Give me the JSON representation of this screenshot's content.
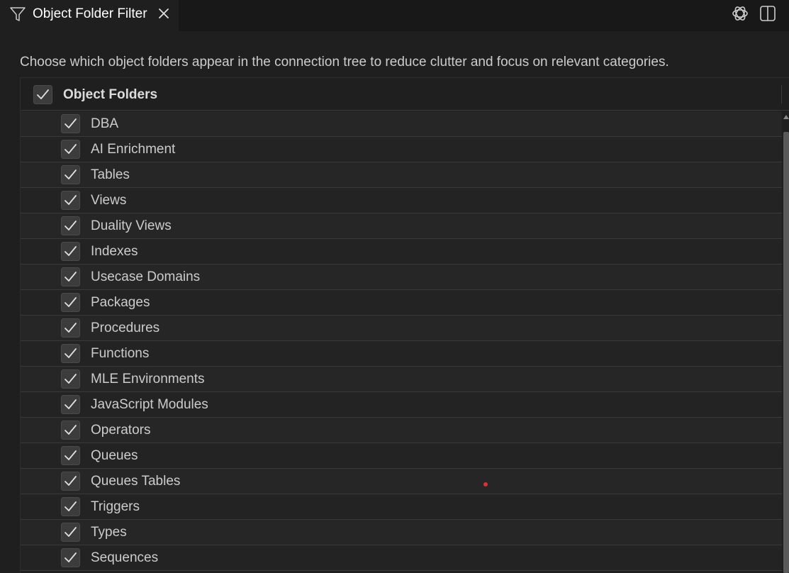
{
  "tab": {
    "title": "Object Folder Filter",
    "icon": "filter-icon"
  },
  "top_right_icons": [
    "openai-icon",
    "split-editor-icon"
  ],
  "description": "Choose which object folders appear in the connection tree to reduce clutter and focus on relevant categories.",
  "tree": {
    "header_label": "Object Folders",
    "header_checked": true,
    "items": [
      {
        "label": "DBA",
        "checked": true
      },
      {
        "label": "AI Enrichment",
        "checked": true
      },
      {
        "label": "Tables",
        "checked": true
      },
      {
        "label": "Views",
        "checked": true
      },
      {
        "label": "Duality Views",
        "checked": true
      },
      {
        "label": "Indexes",
        "checked": true
      },
      {
        "label": "Usecase Domains",
        "checked": true
      },
      {
        "label": "Packages",
        "checked": true
      },
      {
        "label": "Procedures",
        "checked": true
      },
      {
        "label": "Functions",
        "checked": true
      },
      {
        "label": "MLE Environments",
        "checked": true
      },
      {
        "label": "JavaScript Modules",
        "checked": true
      },
      {
        "label": "Operators",
        "checked": true
      },
      {
        "label": "Queues",
        "checked": true
      },
      {
        "label": "Queues Tables",
        "checked": true
      },
      {
        "label": "Triggers",
        "checked": true
      },
      {
        "label": "Types",
        "checked": true
      },
      {
        "label": "Sequences",
        "checked": true
      }
    ]
  },
  "colors": {
    "background": "#1f1f1f",
    "tabbar": "#181818",
    "checkbox_bg": "#3c3c3c",
    "text": "#cccccc"
  }
}
